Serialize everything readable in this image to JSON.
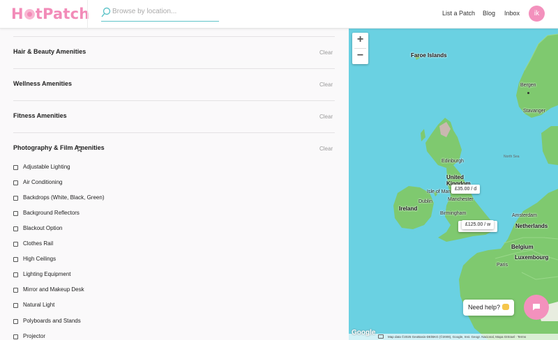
{
  "header": {
    "logo": "HotPatch",
    "search_placeholder": "Browse by location...",
    "nav": [
      "List a Patch",
      "Blog",
      "Inbox"
    ],
    "avatar_initials": "ik"
  },
  "sections": [
    {
      "title": "Hair & Beauty Amenities",
      "clear": "Clear"
    },
    {
      "title": "Wellness Amenities",
      "clear": "Clear"
    },
    {
      "title": "Fitness Amenities",
      "clear": "Clear"
    },
    {
      "title": "Photography & Film Amenities",
      "clear": "Clear"
    }
  ],
  "photography_options": [
    {
      "label": "Adjustable Lighting",
      "checked": false
    },
    {
      "label": "Air Conditioning",
      "checked": false
    },
    {
      "label": "Backdrops (White, Black, Green)",
      "checked": false
    },
    {
      "label": "Background Reflectors",
      "checked": false
    },
    {
      "label": "Blackout Option",
      "checked": false
    },
    {
      "label": "Clothes Rail",
      "checked": false
    },
    {
      "label": "High Ceilings",
      "checked": false
    },
    {
      "label": "Lighting Equipment",
      "checked": false
    },
    {
      "label": "Mirror and Makeup Desk",
      "checked": false
    },
    {
      "label": "Natural Light",
      "checked": false
    },
    {
      "label": "Polyboards and Stands",
      "checked": false
    },
    {
      "label": "Projector",
      "checked": false
    }
  ],
  "map": {
    "zoom_in": "+",
    "zoom_out": "−",
    "places": {
      "faroe": "Faroe Islands",
      "bergen": "Bergen",
      "stavanger": "Stavanger",
      "north_sea": "North Sea",
      "edinburgh": "Edinburgh",
      "united_kingdom": "United Kingdom",
      "isle_of_man": "Isle of Man",
      "dublin": "Dublin",
      "ireland": "Ireland",
      "manchester": "Manchester",
      "birmingham": "Birmingham",
      "amsterdam": "Amsterdam",
      "netherlands": "Netherlands",
      "belgium": "Belgium",
      "luxembourg": "Luxembourg",
      "paris": "Paris"
    },
    "price_pins": [
      "£35.00 / d",
      "£125.00 / w"
    ],
    "help_label": "Need help?",
    "google": "Google",
    "attribution": "Map data ©2025 GeoBasis-DE/BKG (©2009), Google, Inst. Geogr. Nacional, Mapa GISrael",
    "terms": "Terms",
    "colors": {
      "water": "#6ad1e2",
      "land": "#7fc96f",
      "brand": "#f391bd"
    }
  }
}
